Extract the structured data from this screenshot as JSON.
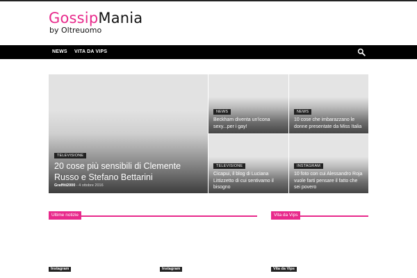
{
  "site": {
    "logo_part1": "Gossip",
    "logo_part2": "Mania",
    "logo_sub": "by Oltreuomo"
  },
  "nav": {
    "items": [
      {
        "label": "NEWS"
      },
      {
        "label": "VITA DA VIPS"
      }
    ],
    "search_icon": "search-icon"
  },
  "featured": {
    "main": {
      "category": "TELEVISIONE",
      "title": "20 cose più sensibili di Clemente Russo e Stefano Bettarini",
      "author": "Graffiti2000",
      "date": "4 ottobre 2016"
    },
    "side": [
      {
        "category": "NEWS",
        "title": "Beckham diventa un'icona sexy...per i gay!"
      },
      {
        "category": "NEWS",
        "title": "10 cose che imbarazzano le donne presentate da Miss Italia"
      },
      {
        "category": "TELEVISIONE",
        "title": "Cicapui, il blog di Luciana Littizzetto di cui sentivamo il bisogno"
      },
      {
        "category": "INSTAGRAM",
        "title": "10 foto con cui Alessandro Roja vuole farti pensare il fatto che sei povero"
      }
    ]
  },
  "sections": {
    "latest": "Ultime notizie",
    "vips": "Vita da Vips"
  },
  "bottom_tags": [
    "Instagram",
    "Instagram",
    "Vita da Vips"
  ],
  "colors": {
    "accent": "#e8298b",
    "navbar": "#000000"
  }
}
